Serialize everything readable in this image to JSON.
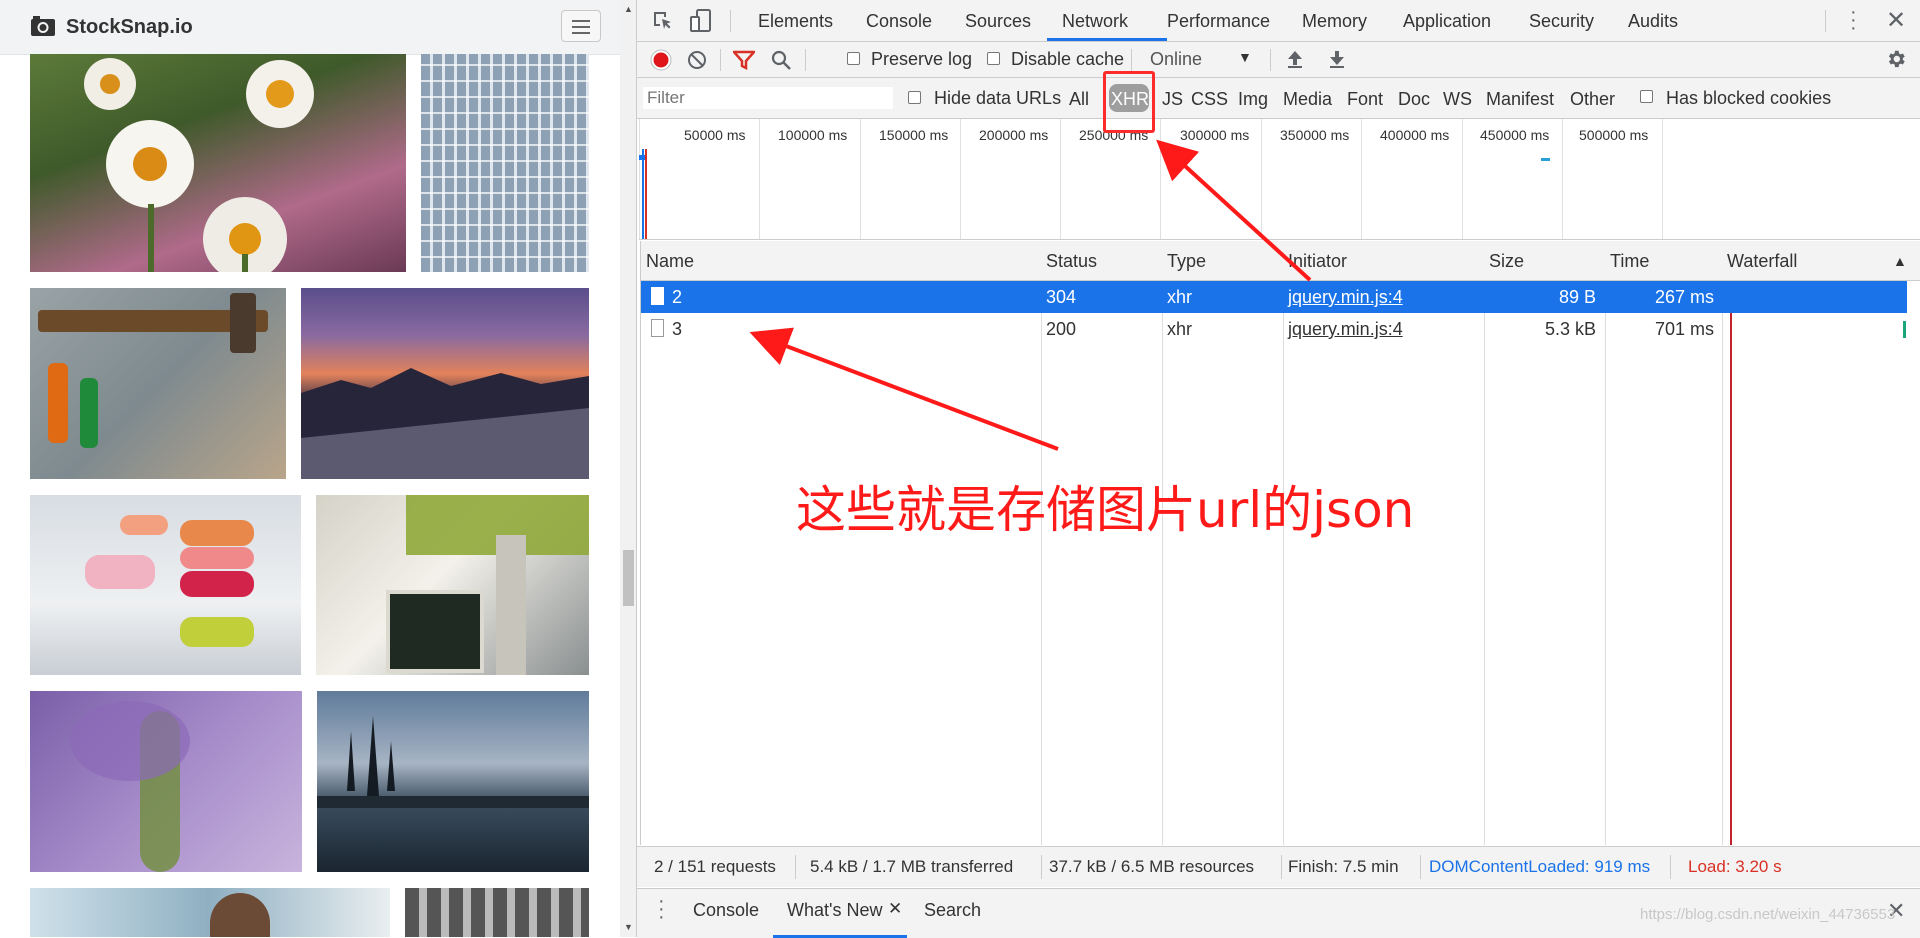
{
  "site": {
    "name": "StockSnap.io"
  },
  "devtools": {
    "tabs": [
      "Elements",
      "Console",
      "Sources",
      "Network",
      "Performance",
      "Memory",
      "Application",
      "Security",
      "Audits"
    ],
    "active_tab": "Network",
    "toolbar": {
      "preserve_log": "Preserve log",
      "disable_cache": "Disable cache",
      "throttle": "Online"
    },
    "filter": {
      "placeholder": "Filter",
      "hide_data_urls": "Hide data URLs",
      "types": [
        "All",
        "XHR",
        "JS",
        "CSS",
        "Img",
        "Media",
        "Font",
        "Doc",
        "WS",
        "Manifest",
        "Other"
      ],
      "active_type": "XHR",
      "has_blocked_cookies": "Has blocked cookies"
    },
    "overview_ticks": [
      "50000 ms",
      "100000 ms",
      "150000 ms",
      "200000 ms",
      "250000 ms",
      "300000 ms",
      "350000 ms",
      "400000 ms",
      "450000 ms",
      "500000 ms"
    ],
    "columns": [
      "Name",
      "Status",
      "Type",
      "Initiator",
      "Size",
      "Time",
      "Waterfall"
    ],
    "rows": [
      {
        "name": "2",
        "status": "304",
        "type": "xhr",
        "initiator": "jquery.min.js:4",
        "size": "89 B",
        "time": "267 ms"
      },
      {
        "name": "3",
        "status": "200",
        "type": "xhr",
        "initiator": "jquery.min.js:4",
        "size": "5.3 kB",
        "time": "701 ms"
      }
    ],
    "summary": {
      "requests": "2 / 151 requests",
      "transferred": "5.4 kB / 1.7 MB transferred",
      "resources": "37.7 kB / 6.5 MB resources",
      "finish": "Finish: 7.5 min",
      "dom_content_loaded": "DOMContentLoaded: 919 ms",
      "load": "Load: 3.20 s"
    },
    "drawer_tabs": [
      "Console",
      "What's New",
      "Search"
    ]
  },
  "annotation": {
    "text": "这些就是存储图片url的json"
  },
  "watermark": "https://blog.csdn.net/weixin_44736553",
  "colors": {
    "selected_row": "#1a73e8",
    "annotation": "#ff1a1a",
    "dcl": "#1a73e8",
    "load": "#d93025"
  }
}
